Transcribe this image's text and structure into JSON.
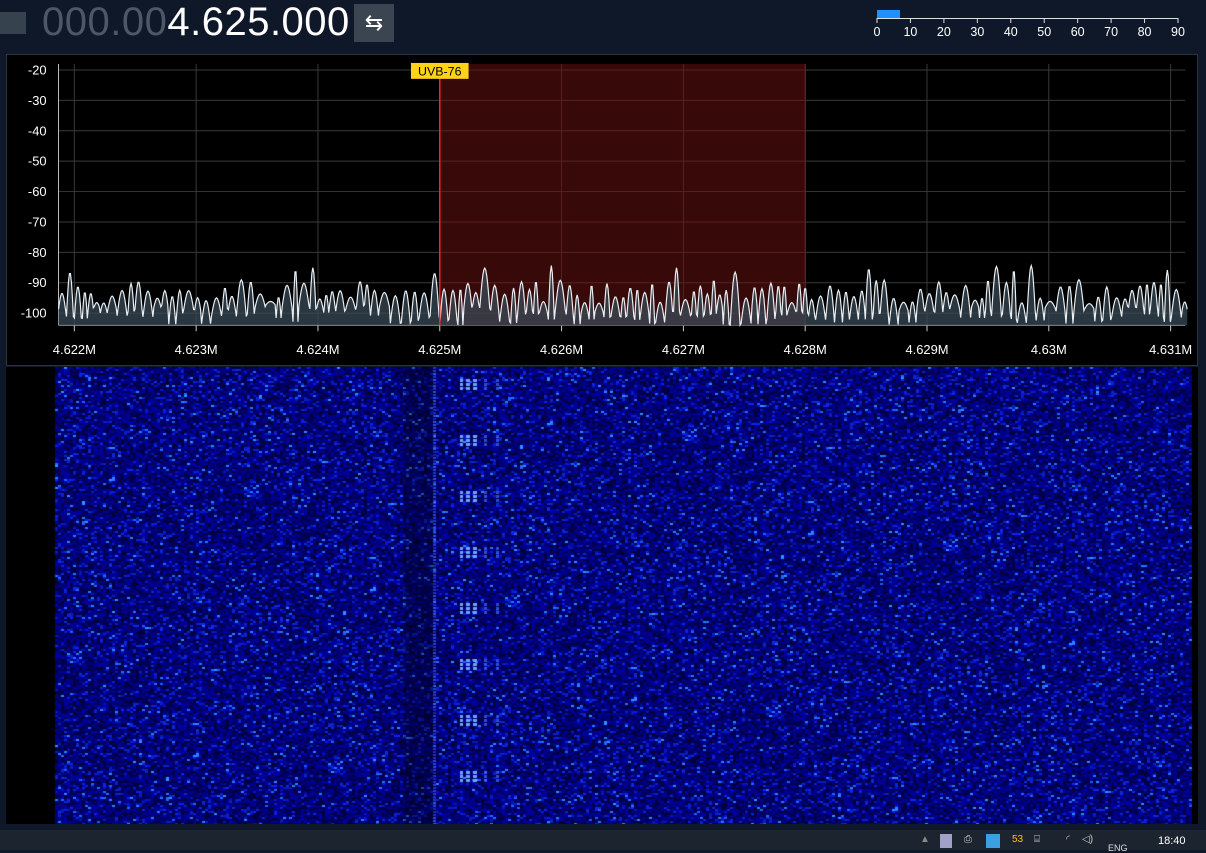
{
  "header": {
    "freq_dim": "000.00",
    "freq_bright": "4.625.000",
    "swap_icon": "swap-icon",
    "swap_glyph": "⇆"
  },
  "meter": {
    "level": 7,
    "min": 0,
    "max": 90,
    "labels": [
      "0",
      "10",
      "20",
      "30",
      "40",
      "50",
      "60",
      "70",
      "80",
      "90"
    ],
    "fill_color": "#1e90ff"
  },
  "spectrum": {
    "y_labels": [
      "-20",
      "-30",
      "-40",
      "-50",
      "-60",
      "-70",
      "-80",
      "-90",
      "-100"
    ],
    "y_values": [
      -20,
      -30,
      -40,
      -50,
      -60,
      -70,
      -80,
      -90,
      -100
    ],
    "x_labels": [
      "4.622M",
      "4.623M",
      "4.624M",
      "4.625M",
      "4.626M",
      "4.627M",
      "4.628M",
      "4.629M",
      "4.63M",
      "4.631M"
    ],
    "x_values": [
      4.622,
      4.623,
      4.624,
      4.625,
      4.626,
      4.627,
      4.628,
      4.629,
      4.63,
      4.631
    ],
    "x_range": [
      4.62187,
      4.63112
    ],
    "y_range": [
      -18,
      -104
    ],
    "filter_start": 4.625,
    "filter_end": 4.628,
    "marker_label": "UVB-76",
    "marker_freq": 4.625,
    "trace_color": "#e8eef2",
    "filter_color": "#3a0a0a",
    "marker_color": "#ff2020",
    "label_bg": "#ffd21a"
  },
  "waterfall": {
    "base_color": "#00007a",
    "signal_color": "#3a78ff"
  },
  "taskbar": {
    "lang": "ENG",
    "time": "18:40",
    "tray_badge": "53"
  }
}
